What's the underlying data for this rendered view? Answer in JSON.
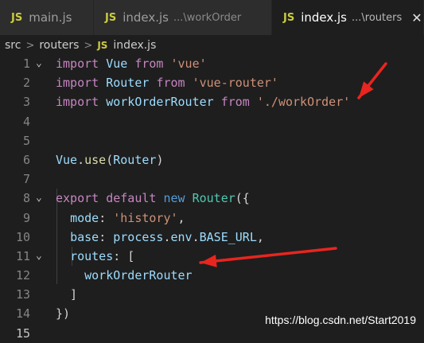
{
  "tabs": [
    {
      "icon": "JS",
      "label": "main.js",
      "desc": "",
      "active": false
    },
    {
      "icon": "JS",
      "label": "index.js",
      "desc": "...\\workOrder",
      "active": false
    },
    {
      "icon": "JS",
      "label": "index.js",
      "desc": "...\\routers",
      "active": true,
      "close": "✕"
    }
  ],
  "breadcrumb": {
    "parts": [
      "src",
      "routers"
    ],
    "separator": ">",
    "file_icon": "JS",
    "file": "index.js"
  },
  "code_lines": [
    {
      "n": "1",
      "fold": "⌄",
      "tokens": [
        [
          "kw",
          "import"
        ],
        [
          "",
          " "
        ],
        [
          "var",
          "Vue"
        ],
        [
          "",
          " "
        ],
        [
          "kw",
          "from"
        ],
        [
          "",
          " "
        ],
        [
          "str",
          "'vue'"
        ]
      ]
    },
    {
      "n": "2",
      "tokens": [
        [
          "kw",
          "import"
        ],
        [
          "",
          " "
        ],
        [
          "var",
          "Router"
        ],
        [
          "",
          " "
        ],
        [
          "kw",
          "from"
        ],
        [
          "",
          " "
        ],
        [
          "str",
          "'vue-router'"
        ]
      ]
    },
    {
      "n": "3",
      "tokens": [
        [
          "kw",
          "import"
        ],
        [
          "",
          " "
        ],
        [
          "var",
          "workOrderRouter"
        ],
        [
          "",
          " "
        ],
        [
          "kw",
          "from"
        ],
        [
          "",
          " "
        ],
        [
          "str",
          "'./workOrder'"
        ]
      ]
    },
    {
      "n": "4",
      "tokens": []
    },
    {
      "n": "5",
      "tokens": []
    },
    {
      "n": "6",
      "tokens": [
        [
          "var",
          "Vue"
        ],
        [
          "",
          "."
        ],
        [
          "fn",
          "use"
        ],
        [
          "",
          "("
        ],
        [
          "var",
          "Router"
        ],
        [
          "",
          ")"
        ]
      ]
    },
    {
      "n": "7",
      "tokens": []
    },
    {
      "n": "8",
      "fold": "⌄",
      "tokens": [
        [
          "kw",
          "export"
        ],
        [
          "",
          " "
        ],
        [
          "kw",
          "default"
        ],
        [
          "",
          " "
        ],
        [
          "kwb",
          "new"
        ],
        [
          "",
          " "
        ],
        [
          "cls",
          "Router"
        ],
        [
          "",
          "({"
        ]
      ]
    },
    {
      "n": "9",
      "tokens": [
        [
          "",
          "  "
        ],
        [
          "var",
          "mode"
        ],
        [
          "",
          ": "
        ],
        [
          "str",
          "'history'"
        ],
        [
          "",
          ","
        ]
      ]
    },
    {
      "n": "10",
      "tokens": [
        [
          "",
          "  "
        ],
        [
          "var",
          "base"
        ],
        [
          "",
          ": "
        ],
        [
          "var",
          "process"
        ],
        [
          "",
          "."
        ],
        [
          "var",
          "env"
        ],
        [
          "",
          "."
        ],
        [
          "var",
          "BASE_URL"
        ],
        [
          "",
          ","
        ]
      ]
    },
    {
      "n": "11",
      "fold": "⌄",
      "tokens": [
        [
          "",
          "  "
        ],
        [
          "var",
          "routes"
        ],
        [
          "",
          ": ["
        ]
      ]
    },
    {
      "n": "12",
      "tokens": [
        [
          "",
          "    "
        ],
        [
          "var",
          "workOrderRouter"
        ]
      ]
    },
    {
      "n": "13",
      "tokens": [
        [
          "",
          "  ]"
        ]
      ]
    },
    {
      "n": "14",
      "tokens": [
        [
          "",
          "})"
        ]
      ]
    },
    {
      "n": "15",
      "current": true,
      "tokens": []
    }
  ],
  "watermark": "https://blog.csdn.net/Start2019",
  "colors": {
    "arrow": "#e8251f",
    "keyword": "#c586c0",
    "string": "#ce9178",
    "variable": "#9cdcfe",
    "class": "#4ec9b0"
  }
}
